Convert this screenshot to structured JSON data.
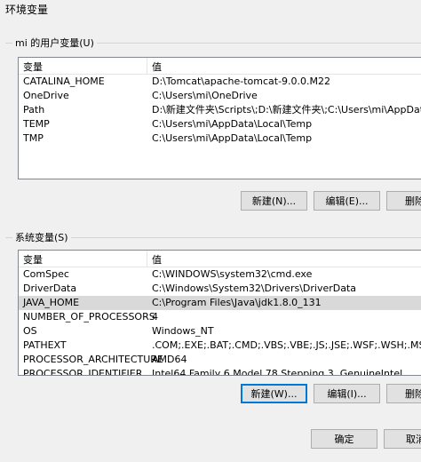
{
  "window": {
    "title": "环境变量"
  },
  "user_section": {
    "label": "mi 的用户变量(U)",
    "columns": [
      "变量",
      "值"
    ],
    "rows": [
      {
        "name": "CATALINA_HOME",
        "value": "D:\\Tomcat\\apache-tomcat-9.0.0.M22"
      },
      {
        "name": "OneDrive",
        "value": "C:\\Users\\mi\\OneDrive"
      },
      {
        "name": "Path",
        "value": "D:\\新建文件夹\\Scripts\\;D:\\新建文件夹\\;C:\\Users\\mi\\AppData\\Lo"
      },
      {
        "name": "TEMP",
        "value": "C:\\Users\\mi\\AppData\\Local\\Temp"
      },
      {
        "name": "TMP",
        "value": "C:\\Users\\mi\\AppData\\Local\\Temp"
      }
    ],
    "buttons": {
      "new": "新建(N)...",
      "edit": "编辑(E)...",
      "delete": "删除"
    }
  },
  "system_section": {
    "label": "系统变量(S)",
    "columns": [
      "变量",
      "值"
    ],
    "rows": [
      {
        "name": "ComSpec",
        "value": "C:\\WINDOWS\\system32\\cmd.exe"
      },
      {
        "name": "DriverData",
        "value": "C:\\Windows\\System32\\Drivers\\DriverData"
      },
      {
        "name": "JAVA_HOME",
        "value": "C:\\Program Files\\Java\\jdk1.8.0_131"
      },
      {
        "name": "NUMBER_OF_PROCESSORS",
        "value": "4"
      },
      {
        "name": "OS",
        "value": "Windows_NT"
      },
      {
        "name": "PATHEXT",
        "value": ".COM;.EXE;.BAT;.CMD;.VBS;.VBE;.JS;.JSE;.WSF;.WSH;.MSC"
      },
      {
        "name": "PROCESSOR_ARCHITECTURE",
        "value": "AMD64"
      },
      {
        "name": "PROCESSOR_IDENTIFIER",
        "value": "Intel64 Family 6 Model 78 Stepping 3, GenuineIntel"
      }
    ],
    "selected_index": 2,
    "buttons": {
      "new": "新建(W)...",
      "edit": "编辑(I)...",
      "delete": "删除"
    }
  },
  "footer": {
    "ok": "确定",
    "cancel": "取消"
  }
}
